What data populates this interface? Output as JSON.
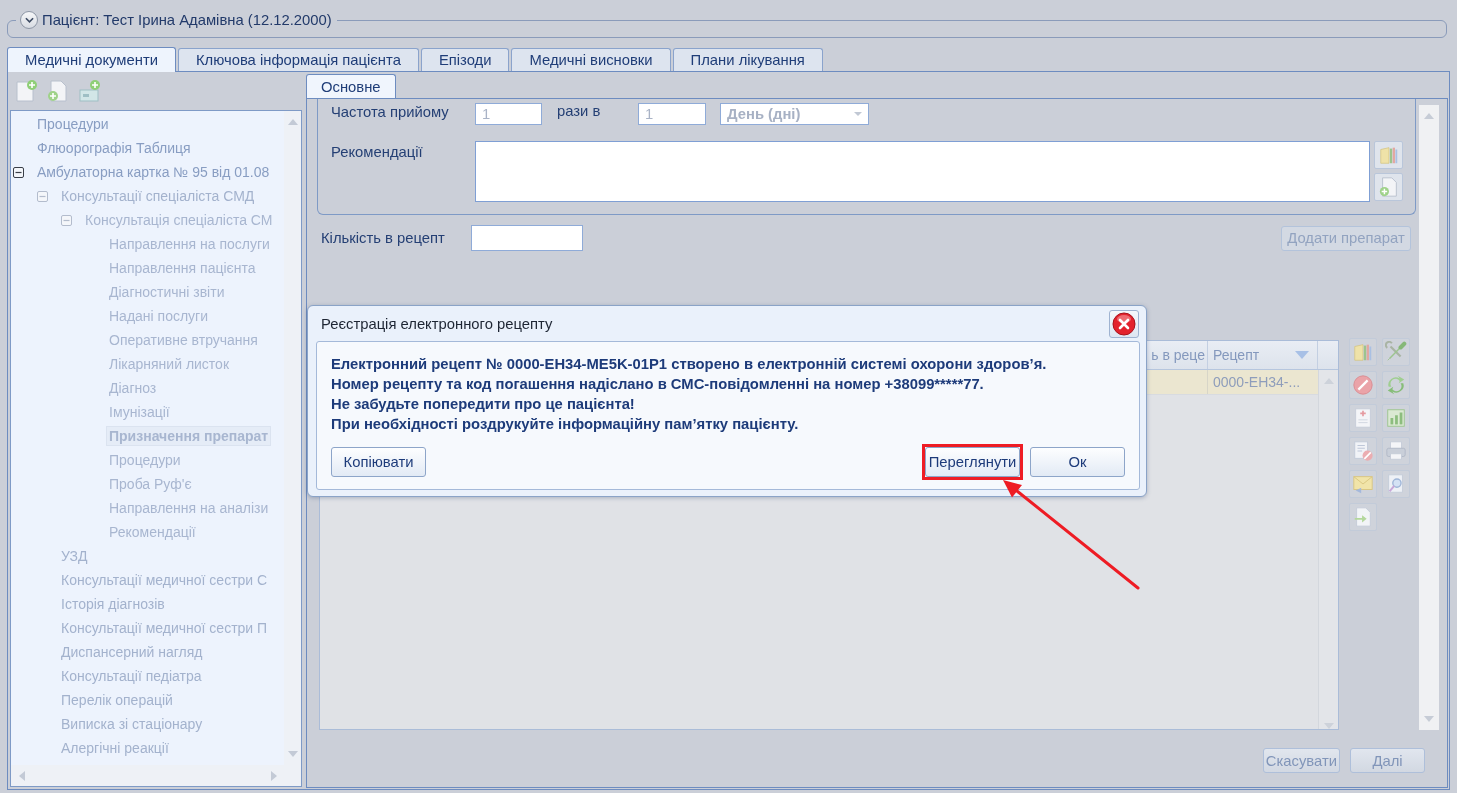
{
  "patient": {
    "title": "Пацієнт: Тест Ірина Адамівна (12.12.2000)"
  },
  "tabs": [
    {
      "label": "Медичні документи",
      "selected": true
    },
    {
      "label": "Ключова інформація пацієнта",
      "selected": false
    },
    {
      "label": "Епізоди",
      "selected": false
    },
    {
      "label": "Медичні висновки",
      "selected": false
    },
    {
      "label": "Плани лікування",
      "selected": false
    }
  ],
  "tree": {
    "items": [
      {
        "label": "Процедури",
        "selected": false
      },
      {
        "label": "Флюорографія Таблиця",
        "selected": false
      },
      {
        "label": "Амбулаторна картка № 95 від 01.08",
        "selected": false,
        "expanded": true,
        "children": [
          {
            "label": "Консультації спеціаліста СМД",
            "selected": false,
            "expanded": true,
            "children": [
              {
                "label": "Консультація спеціаліста СМ",
                "selected": false,
                "expanded": true,
                "children": [
                  {
                    "label": "Направлення на послуги",
                    "selected": false
                  },
                  {
                    "label": "Направлення пацієнта",
                    "selected": false
                  },
                  {
                    "label": "Діагностичні звіти",
                    "selected": false
                  },
                  {
                    "label": "Надані послуги",
                    "selected": false
                  },
                  {
                    "label": "Оперативне втручання",
                    "selected": false
                  },
                  {
                    "label": "Лікарняний листок",
                    "selected": false
                  },
                  {
                    "label": "Діагноз",
                    "selected": false
                  },
                  {
                    "label": "Імунізації",
                    "selected": false
                  },
                  {
                    "label": "Призначення препарат",
                    "selected": true
                  },
                  {
                    "label": "Процедури",
                    "selected": false
                  },
                  {
                    "label": "Проба Руф'є",
                    "selected": false
                  },
                  {
                    "label": "Направлення на аналізи",
                    "selected": false
                  },
                  {
                    "label": "Рекомендації",
                    "selected": false
                  }
                ]
              }
            ]
          },
          {
            "label": "УЗД",
            "selected": false
          },
          {
            "label": "Консультації медичної сестри С",
            "selected": false
          },
          {
            "label": "Історія діагнозів",
            "selected": false
          },
          {
            "label": "Консультації медичної сестри П",
            "selected": false
          },
          {
            "label": "Диспансерний нагляд",
            "selected": false
          },
          {
            "label": "Консультації педіатра",
            "selected": false
          },
          {
            "label": "Перелік операцій",
            "selected": false
          },
          {
            "label": "Виписка зі стаціонару",
            "selected": false
          },
          {
            "label": "Алергічні реакції",
            "selected": false
          }
        ]
      }
    ]
  },
  "form": {
    "tabs": [
      {
        "label": "Основне",
        "selected": true
      }
    ],
    "frequency": {
      "label": "Частота прийому",
      "value": "1",
      "separator": "рази в",
      "interval": "1",
      "unit": "День (дні)"
    },
    "recommendations": {
      "label": "Рекомендації"
    },
    "quantity": {
      "label": "Кількість в рецепт"
    },
    "add_button": "Додати препарат",
    "grid": {
      "columns": [
        {
          "label": "ь в реце",
          "sorted": false
        },
        {
          "label": "Рецепт",
          "sorted": true
        }
      ],
      "rows": [
        {
          "selected": true,
          "recipe": "0000-EH34-..."
        }
      ]
    },
    "buttons": [
      "Скасувати",
      "Далі"
    ]
  },
  "dialog": {
    "title": "Реєстрація електронного рецепту",
    "message_lines": [
      "Електронний рецепт № 0000-EH34-ME5K-01P1 створено в електронній системі охорони здоров’я.",
      "Номер рецепту та код погашення надіслано в СМС-повідомленні на номер +38099*****77.",
      "Не забудьте попередити про це пацієнта!",
      "При необхідності роздрукуйте інформаційну пам’ятку пацієнту."
    ],
    "buttons": [
      {
        "label": "Копіювати",
        "highlighted": false
      },
      {
        "label": "Переглянути",
        "highlighted": true
      },
      {
        "label": "Ок",
        "highlighted": false
      }
    ]
  }
}
